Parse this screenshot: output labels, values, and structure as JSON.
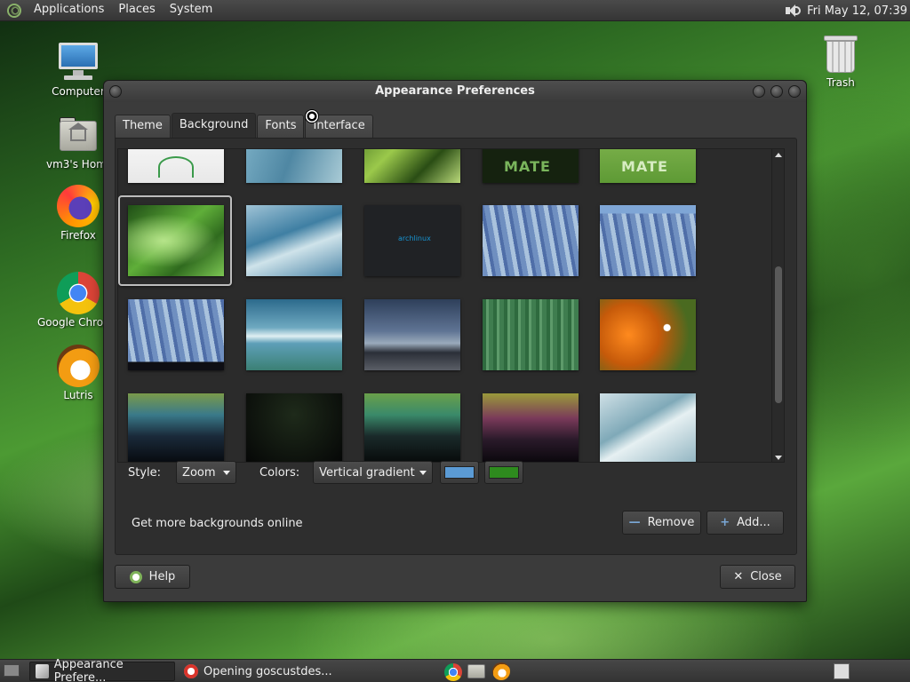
{
  "top_panel": {
    "menus": [
      "Applications",
      "Places",
      "System"
    ],
    "clock": "Fri May 12, 07:39"
  },
  "desktop_icons": {
    "computer": "Computer",
    "home": "vm3's Home",
    "firefox": "Firefox",
    "chrome": "Google Chrome",
    "lutris": "Lutris",
    "trash": "Trash"
  },
  "window": {
    "title": "Appearance Preferences",
    "tabs": [
      "Theme",
      "Background",
      "Fonts",
      "Interface"
    ],
    "active_tab": "Background",
    "style_label": "Style:",
    "style_value": "Zoom",
    "colors_label": "Colors:",
    "colors_value": "Vertical gradient",
    "primary_color": "#5b9bd5",
    "secondary_color": "#2e8b1e",
    "online_link": "Get more backgrounds online",
    "remove_label": "Remove",
    "add_label": "Add...",
    "help_label": "Help",
    "close_label": "Close",
    "archlinux_text": "archlinux",
    "mate_text": "MATE"
  },
  "taskbar": {
    "items": [
      "Appearance Prefere...",
      "Opening goscustdes..."
    ]
  }
}
